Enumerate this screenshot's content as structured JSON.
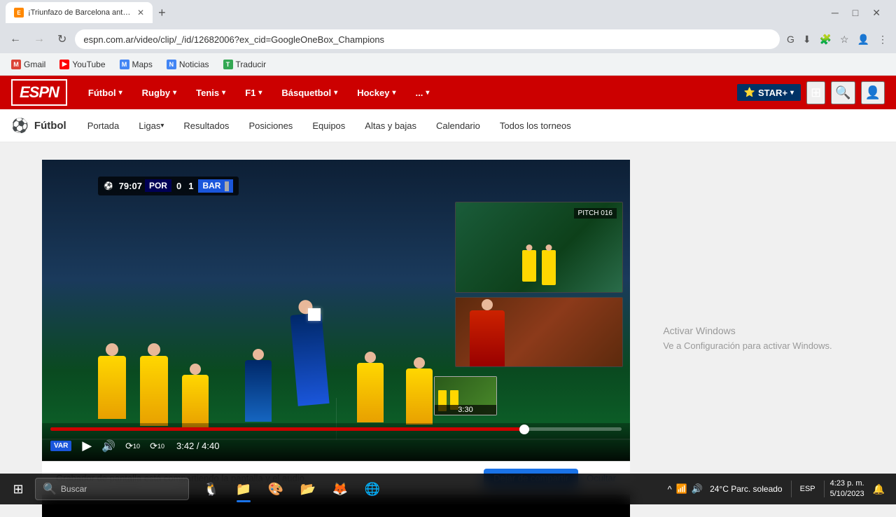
{
  "browser": {
    "tab_title": "¡Triunfazo de Barcelona ante Po...",
    "favicon_letter": "E",
    "url": "espn.com.ar/video/clip/_/id/12682006?ex_cid=GoogleOneBox_Champions",
    "bookmarks": [
      {
        "label": "Gmail",
        "icon": "M",
        "color": "#DB4437"
      },
      {
        "label": "YouTube",
        "icon": "▶",
        "color": "#FF0000"
      },
      {
        "label": "Maps",
        "icon": "M",
        "color": "#4285F4"
      },
      {
        "label": "Noticias",
        "icon": "N",
        "color": "#4285F4"
      },
      {
        "label": "Traducir",
        "icon": "T",
        "color": "#4285F4"
      }
    ]
  },
  "espn": {
    "logo": "ESPN",
    "nav_items": [
      {
        "label": "Fútbol",
        "has_dropdown": true
      },
      {
        "label": "Rugby",
        "has_dropdown": true
      },
      {
        "label": "Tenis",
        "has_dropdown": true
      },
      {
        "label": "F1",
        "has_dropdown": true
      },
      {
        "label": "Básquetbol",
        "has_dropdown": true
      },
      {
        "label": "Hockey",
        "has_dropdown": true
      },
      {
        "label": "...",
        "has_dropdown": false
      }
    ],
    "star_plus": "STAR+",
    "more_btn": "⋮"
  },
  "futbol_nav": {
    "icon": "⚽",
    "label": "Fútbol",
    "items": [
      "Portada",
      "Ligas",
      "Resultados",
      "Posiciones",
      "Equipos",
      "Altas y bajas",
      "Calendario",
      "Todos los torneos"
    ]
  },
  "video": {
    "score_time": "79:07",
    "team1": "POR",
    "score1": "0",
    "score2": "1",
    "team2": "BAR",
    "seek_preview_time": "3:30",
    "current_time": "3:42",
    "total_time": "4:40",
    "progress_pct": 83,
    "pitch_label": "PITCH 016",
    "var_label": "VAR"
  },
  "notification": {
    "text": "Grabador de pantalla está compartiendo la pantalla y el audio.",
    "btn_primary": "Dejar de compartir",
    "btn_secondary": "Ocultar"
  },
  "activate_windows": {
    "line1": "Activar Windows",
    "line2": "Ve a Configuración para activar Windows."
  },
  "taskbar": {
    "search_placeholder": "Buscar",
    "apps": [
      {
        "icon": "⊞",
        "name": "start"
      },
      {
        "icon": "🔍",
        "name": "search"
      },
      {
        "icon": "🐧",
        "name": "linux"
      },
      {
        "icon": "📁",
        "name": "file-explorer"
      },
      {
        "icon": "🦊",
        "name": "firefox"
      },
      {
        "icon": "🌐",
        "name": "chrome"
      }
    ],
    "systray": {
      "time": "4:23 p. m.",
      "date": "5/10/2023",
      "temp": "24°C",
      "weather": "Parc. soleado",
      "lang": "ESP"
    }
  }
}
